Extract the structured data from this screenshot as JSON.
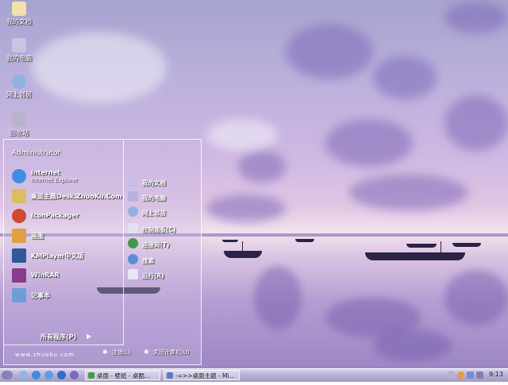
{
  "desktop_icons": [
    {
      "label": "我的文档",
      "icon": "folder-documents-icon"
    },
    {
      "label": "我的电脑",
      "icon": "computer-icon"
    },
    {
      "label": "网上邻居",
      "icon": "network-icon"
    },
    {
      "label": "回收站",
      "icon": "recycle-bin-icon"
    }
  ],
  "start_menu": {
    "user": "Administrator",
    "pinned": [
      {
        "title": "Internet",
        "subtitle": "Internet Explorer",
        "icon": "internet-explorer-icon"
      },
      {
        "title": "桌面主题Desk.ZhuoKu.Com",
        "subtitle": "",
        "icon": "zhuoku-icon"
      },
      {
        "title": "IconPackager",
        "subtitle": "",
        "icon": "iconpackager-icon"
      },
      {
        "title": "画图",
        "subtitle": "",
        "icon": "paint-icon"
      },
      {
        "title": "KMPlayer中文版",
        "subtitle": "",
        "icon": "kmplayer-icon"
      },
      {
        "title": "WinRAR",
        "subtitle": "",
        "icon": "winrar-icon"
      },
      {
        "title": "记事本",
        "subtitle": "",
        "icon": "notepad-icon"
      }
    ],
    "all_programs": "所有程序(P)",
    "right": [
      {
        "label": "我的文档",
        "icon": "documents-icon"
      },
      {
        "label": "我的电脑",
        "icon": "computer-icon"
      },
      {
        "label": "网上邻居",
        "icon": "network-icon"
      },
      {
        "label": "控制面板(C)",
        "icon": "control-panel-icon"
      },
      {
        "label": "连接到(T)",
        "icon": "connect-icon"
      },
      {
        "label": "搜索",
        "icon": "search-icon"
      },
      {
        "label": "运行(R)",
        "icon": "run-icon"
      }
    ],
    "site": "www.zhuoku.com",
    "logoff": "注销(L)",
    "shutdown": "关闭计算机(U)"
  },
  "taskbar": {
    "tasks": [
      {
        "label": "桌面 - 壁纸 - 桌酷..."
      },
      {
        "label": "-=>>桌面主题 - Mi..."
      }
    ],
    "clock": "9:13"
  },
  "colors": {
    "wallpaper_top": "#a6a3cf",
    "wallpaper_glow": "#f2e2ee",
    "taskbar": "#b7aed6"
  }
}
